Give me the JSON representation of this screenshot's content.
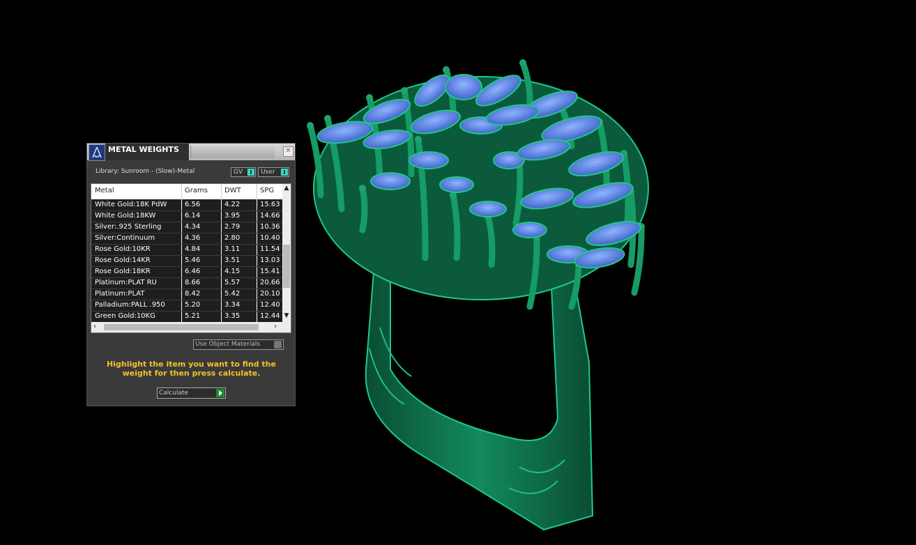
{
  "panel": {
    "title": "METAL WEIGHTS",
    "close_glyph": "✕",
    "library_label": "Library: Sunroom - (Slow)-Metal",
    "gv_label": "GV",
    "user_label": "User",
    "use_object_materials": "Use Object Materials",
    "hint": "Highlight the item you want to find the weight for then press calculate.",
    "calculate_label": "Calculate"
  },
  "table": {
    "columns": [
      "Metal",
      "Grams",
      "DWT",
      "SPG"
    ],
    "rows": [
      [
        "White Gold:18K PdW",
        "6.56",
        "4.22",
        "15.63"
      ],
      [
        "White Gold:18KW",
        "6.14",
        "3.95",
        "14.66"
      ],
      [
        "Silver:.925 Sterling",
        "4.34",
        "2.79",
        "10.36"
      ],
      [
        "Silver:Continuum",
        "4.36",
        "2.80",
        "10.40"
      ],
      [
        "Rose Gold:10KR",
        "4.84",
        "3.11",
        "11.54"
      ],
      [
        "Rose Gold:14KR",
        "5.46",
        "3.51",
        "13.03"
      ],
      [
        "Rose Gold:18KR",
        "6.46",
        "4.15",
        "15.41"
      ],
      [
        "Platinum:PLAT RU",
        "8.66",
        "5.57",
        "20.66"
      ],
      [
        "Platinum:PLAT",
        "8.42",
        "5.42",
        "20.10"
      ],
      [
        "Palladium:PALL .950",
        "5.20",
        "3.34",
        "12.40"
      ],
      [
        "Green Gold:10KG",
        "5.21",
        "3.35",
        "12.44"
      ]
    ]
  },
  "colors": {
    "metal": "#0e6b48",
    "metal_light": "#1f9a6a",
    "stone": "#4f7fe0",
    "hint": "#f3c12a",
    "toggle_on": "#3ad6c3"
  },
  "icons": {
    "app": "app-logo-icon",
    "close": "close-icon",
    "calc": "play-icon"
  }
}
